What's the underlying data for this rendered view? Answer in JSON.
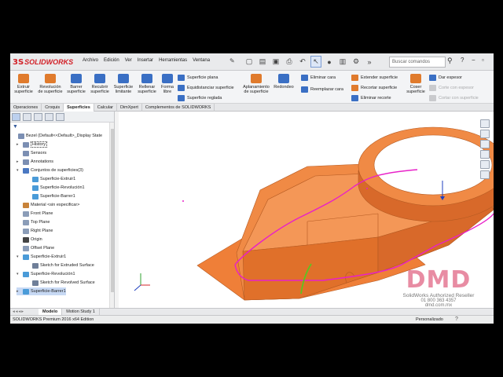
{
  "brand": {
    "prefix": "3S",
    "name": "SOLIDWORKS"
  },
  "menu": [
    "Archivo",
    "Edición",
    "Ver",
    "Insertar",
    "Herramientas",
    "Ventana"
  ],
  "search_placeholder": "Buscar comandos",
  "ribbon": {
    "big_buttons": [
      {
        "label": "Extruir superficie",
        "color": "#e07b2d"
      },
      {
        "label": "Revolución de superficie",
        "color": "#e07b2d"
      },
      {
        "label": "Barrer superficie",
        "color": "#3a6fc4"
      },
      {
        "label": "Recubrir superficie",
        "color": "#3a6fc4"
      },
      {
        "label": "Superficie limitante",
        "color": "#3a6fc4"
      },
      {
        "label": "Rellenar superficie",
        "color": "#3a6fc4"
      },
      {
        "label": "Forma libre",
        "color": "#3a6fc4"
      },
      {
        "label": "Aplanamiento de superficie",
        "color": "#e07b2d"
      },
      {
        "label": "Redondeo",
        "color": "#3a6fc4"
      },
      {
        "label": "Coser superficie",
        "color": "#e07b2d"
      }
    ],
    "small_buttons": [
      {
        "label": "Superficie plana",
        "disabled": false
      },
      {
        "label": "Equidistanciar superficie",
        "disabled": false
      },
      {
        "label": "Superficie reglada",
        "disabled": false
      },
      {
        "label": "Eliminar cara",
        "disabled": false
      },
      {
        "label": "Reemplazar cara",
        "disabled": false
      },
      {
        "label": "Extender superficie",
        "disabled": false
      },
      {
        "label": "Recortar superficie",
        "disabled": false
      },
      {
        "label": "Eliminar recorte",
        "disabled": false
      },
      {
        "label": "Dar espesor",
        "disabled": false
      },
      {
        "label": "Corte con espesor",
        "disabled": true
      },
      {
        "label": "Cortar con superficie",
        "disabled": true
      }
    ]
  },
  "tabs": [
    "Operaciones",
    "Croquis",
    "Superficies",
    "Calcular",
    "DimXpert",
    "Complementos de SOLIDWORKS"
  ],
  "active_tab": "Superficies",
  "tree": {
    "root": "Bezel  (Default<<Default>_Display State",
    "items": [
      {
        "label": "History",
        "icon_color": "#7c8fb3"
      },
      {
        "label": "Sensors",
        "icon_color": "#7c8fb3"
      },
      {
        "label": "Annotations",
        "icon_color": "#7c8fb3"
      },
      {
        "label": "Conjuntos de superficies(3)",
        "icon_color": "#4a78c2"
      },
      {
        "label": "Superficie-Extruir1",
        "icon_color": "#4a9bd8"
      },
      {
        "label": "Superficie-Revolución1",
        "icon_color": "#4a9bd8"
      },
      {
        "label": "Superficie-Barrer1",
        "icon_color": "#4a9bd8"
      },
      {
        "label": "Material <sin especificar>",
        "icon_color": "#c8833a"
      },
      {
        "label": "Front Plane",
        "icon_color": "#8b9db8"
      },
      {
        "label": "Top Plane",
        "icon_color": "#8b9db8"
      },
      {
        "label": "Right Plane",
        "icon_color": "#8b9db8"
      },
      {
        "label": "Origin",
        "icon_color": "#444444"
      },
      {
        "label": "Offset Plane",
        "icon_color": "#8b9db8"
      },
      {
        "label": "Superficie-Extruir1",
        "icon_color": "#4a9bd8"
      },
      {
        "label": "Sketch for Extruded Surface",
        "icon_color": "#6f7f99"
      },
      {
        "label": "Superficie-Revolución1",
        "icon_color": "#4a9bd8"
      },
      {
        "label": "Sketch for Revolved Surface",
        "icon_color": "#6f7f99"
      },
      {
        "label": "Superficie-Barrer1",
        "icon_color": "#4a9bd8"
      }
    ]
  },
  "bottom_tabs": [
    "Modelo",
    "Motion Study 1"
  ],
  "status_left": "SOLIDWORKS Premium 2016 x64 Edition",
  "status_right": "Personalizado",
  "watermark": {
    "logo": "DMD",
    "line1": "SolidWorks Authorized Reseller",
    "line2": "01 800 363 4357",
    "line3": "dmd.com.mx"
  },
  "colors": {
    "surface": "#ef7f38",
    "surface_dark": "#c45f1f",
    "edge_highlight": "#e820c8",
    "selected_edge": "#5cc421"
  }
}
